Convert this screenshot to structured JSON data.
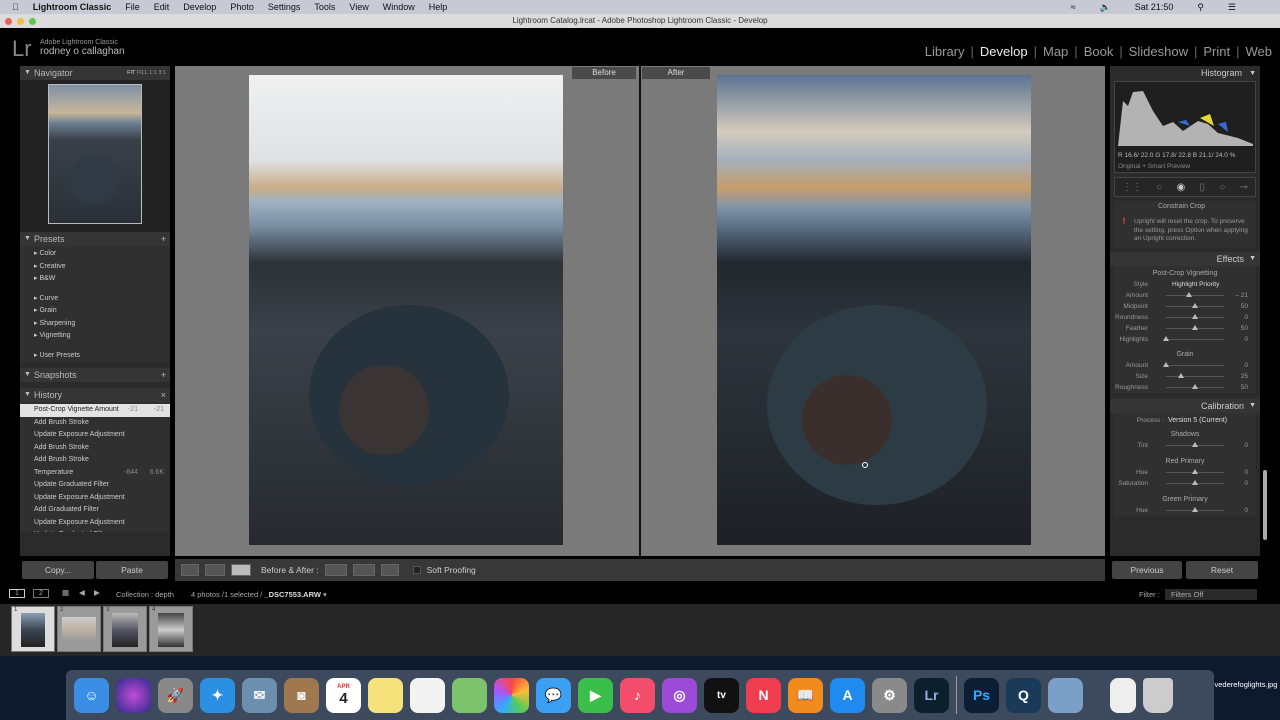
{
  "menubar": {
    "app": "Lightroom Classic",
    "items": [
      "File",
      "Edit",
      "Develop",
      "Photo",
      "Settings",
      "Tools",
      "View",
      "Window",
      "Help"
    ],
    "clock": "Sat 21:50"
  },
  "window": {
    "title": "Lightroom Catalog.lrcat - Adobe Photoshop Lightroom Classic - Develop"
  },
  "identity": {
    "logo": "Lr",
    "product": "Adobe Lightroom Classic",
    "user": "rodney o callaghan"
  },
  "modules": [
    "Library",
    "Develop",
    "Map",
    "Book",
    "Slideshow",
    "Print",
    "Web"
  ],
  "active_module": "Develop",
  "navigator": {
    "title": "Navigator",
    "zoom": [
      "FIT",
      "FILL",
      "1:1",
      "3:1"
    ]
  },
  "presets": {
    "title": "Presets",
    "groups": [
      "Color",
      "Creative",
      "B&W",
      "Curve",
      "Grain",
      "Sharpening",
      "Vignetting",
      "User Presets"
    ]
  },
  "snapshots": {
    "title": "Snapshots"
  },
  "history": {
    "title": "History",
    "items": [
      {
        "label": "Post-Crop Vignette Amount",
        "a": "-21",
        "b": "-21"
      },
      {
        "label": "Add Brush Stroke",
        "a": "",
        "b": ""
      },
      {
        "label": "Update Exposure Adjustment",
        "a": "",
        "b": ""
      },
      {
        "label": "Add Brush Stroke",
        "a": "",
        "b": ""
      },
      {
        "label": "Add Brush Stroke",
        "a": "",
        "b": ""
      },
      {
        "label": "Temperature",
        "a": "-844",
        "b": "6.6K"
      },
      {
        "label": "Update Graduated Filter",
        "a": "",
        "b": ""
      },
      {
        "label": "Update Exposure Adjustment",
        "a": "",
        "b": ""
      },
      {
        "label": "Add Graduated Filter",
        "a": "",
        "b": ""
      },
      {
        "label": "Update Exposure Adjustment",
        "a": "",
        "b": ""
      },
      {
        "label": "Update Graduated Filter",
        "a": "",
        "b": ""
      }
    ]
  },
  "left_buttons": {
    "copy": "Copy...",
    "paste": "Paste"
  },
  "view": {
    "before": "Before",
    "after": "After"
  },
  "toolbar": {
    "before_after": "Before & After :",
    "soft_proofing": "Soft Proofing"
  },
  "histogram": {
    "title": "Histogram",
    "readout": "R 16.6/ 22.0  G 17.8/ 22.8  B 21.1/ 24.0 %",
    "preview": "Original + Smart Preview"
  },
  "crop": {
    "constrain": "Constrain Crop",
    "note": "Upright will reset the crop. To preserve the setting, press Option when applying an Upright correction."
  },
  "effects": {
    "title": "Effects",
    "vignette_title": "Post-Crop Vignetting",
    "style_label": "Style",
    "style_value": "Highlight Priority",
    "sliders": [
      {
        "label": "Amount",
        "value": "– 21",
        "pos": 0.4
      },
      {
        "label": "Midpoint",
        "value": "50",
        "pos": 0.5
      },
      {
        "label": "Roundness",
        "value": "0",
        "pos": 0.5
      },
      {
        "label": "Feather",
        "value": "50",
        "pos": 0.5
      },
      {
        "label": "Highlights",
        "value": "0",
        "pos": 0
      }
    ],
    "grain_title": "Grain",
    "grain": [
      {
        "label": "Amount",
        "value": "0",
        "pos": 0
      },
      {
        "label": "Size",
        "value": "25",
        "pos": 0.25
      },
      {
        "label": "Roughness",
        "value": "50",
        "pos": 0.5
      }
    ]
  },
  "calibration": {
    "title": "Calibration",
    "process_label": "Process :",
    "process_value": "Version 5 (Current)",
    "shadows": "Shadows",
    "tint": {
      "label": "Tint",
      "value": "0",
      "pos": 0.5
    },
    "red": "Red Primary",
    "red_hue": {
      "label": "Hue",
      "value": "0",
      "pos": 0.5
    },
    "red_sat": {
      "label": "Saturation",
      "value": "0",
      "pos": 0.5
    },
    "green": "Green Primary",
    "green_hue": {
      "label": "Hue",
      "value": "0",
      "pos": 0.5
    }
  },
  "right_buttons": {
    "previous": "Previous",
    "reset": "Reset"
  },
  "filmstrip": {
    "screen1": "1",
    "screen2": "2",
    "source": "Collection : depth",
    "count": "4 photos /1 selected /",
    "file": "_DSC7553.ARW",
    "filter_label": "Filter :",
    "filter_value": "Filters Off",
    "thumbs": [
      "1",
      "2",
      "3",
      "4"
    ]
  },
  "dock": {
    "file_label": "vederefoglights.jpg",
    "calendar_month": "APR",
    "calendar_day": "4"
  }
}
